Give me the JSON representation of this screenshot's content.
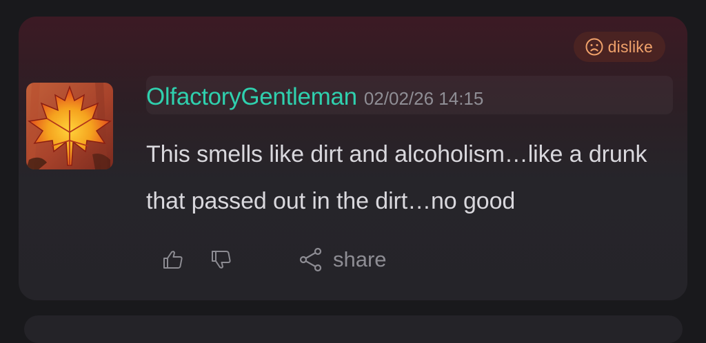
{
  "reaction_badge": {
    "label": "dislike",
    "icon": "frown-face-icon",
    "color": "#f0a26b"
  },
  "comment": {
    "avatar_icon": "maple-leaf-avatar",
    "username": "OlfactoryGentleman",
    "timestamp": "02/02/26 14:15",
    "text": "This smells like dirt and alcoholism…like a drunk that passed out in the dirt…no good",
    "username_color": "#2fd0ae"
  },
  "actions": {
    "like_icon": "thumbs-up-icon",
    "dislike_icon": "thumbs-down-icon",
    "share_icon": "share-icon",
    "share_label": "share"
  }
}
